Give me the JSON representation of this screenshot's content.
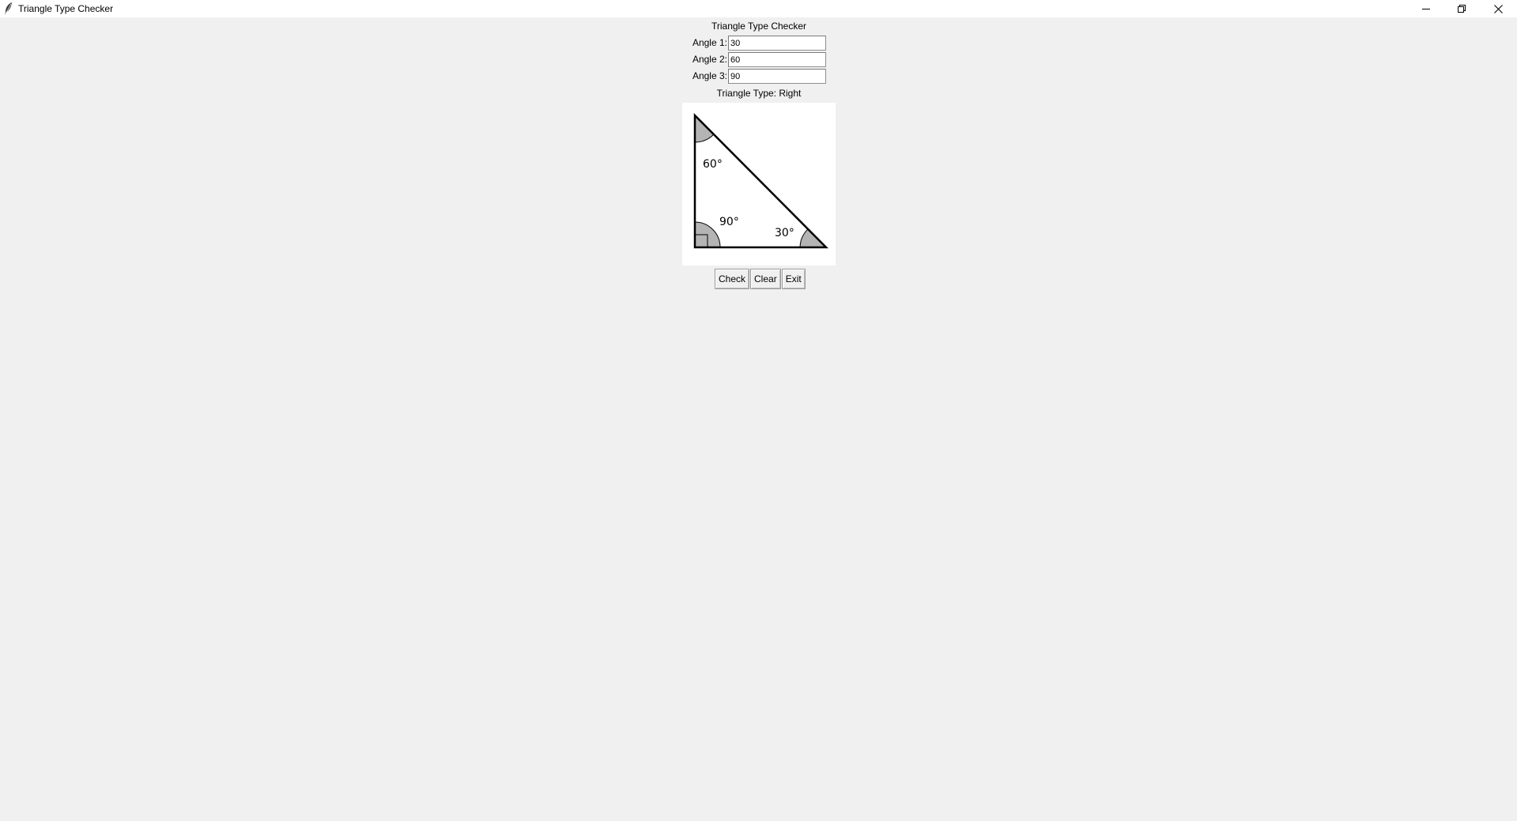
{
  "window": {
    "title": "Triangle Type Checker"
  },
  "form": {
    "heading": "Triangle Type Checker",
    "angles": [
      {
        "label": "Angle 1:",
        "value": "30"
      },
      {
        "label": "Angle 2:",
        "value": "60"
      },
      {
        "label": "Angle 3:",
        "value": "90"
      }
    ],
    "result_text": "Triangle Type: Right"
  },
  "diagram": {
    "top_angle_label": "60°",
    "right_angle_label": "90°",
    "bottom_right_angle_label": "30°"
  },
  "buttons": {
    "check": "Check",
    "clear": "Clear",
    "exit": "Exit"
  },
  "icons": {
    "app": "feather-icon",
    "minimize": "minimize-icon",
    "maximize": "maximize-icon",
    "close": "close-icon"
  },
  "colors": {
    "window_bg": "#f0f0f0",
    "titlebar_bg": "#ffffff",
    "canvas_bg": "#ffffff",
    "angle_fill": "#b4b4b4"
  }
}
